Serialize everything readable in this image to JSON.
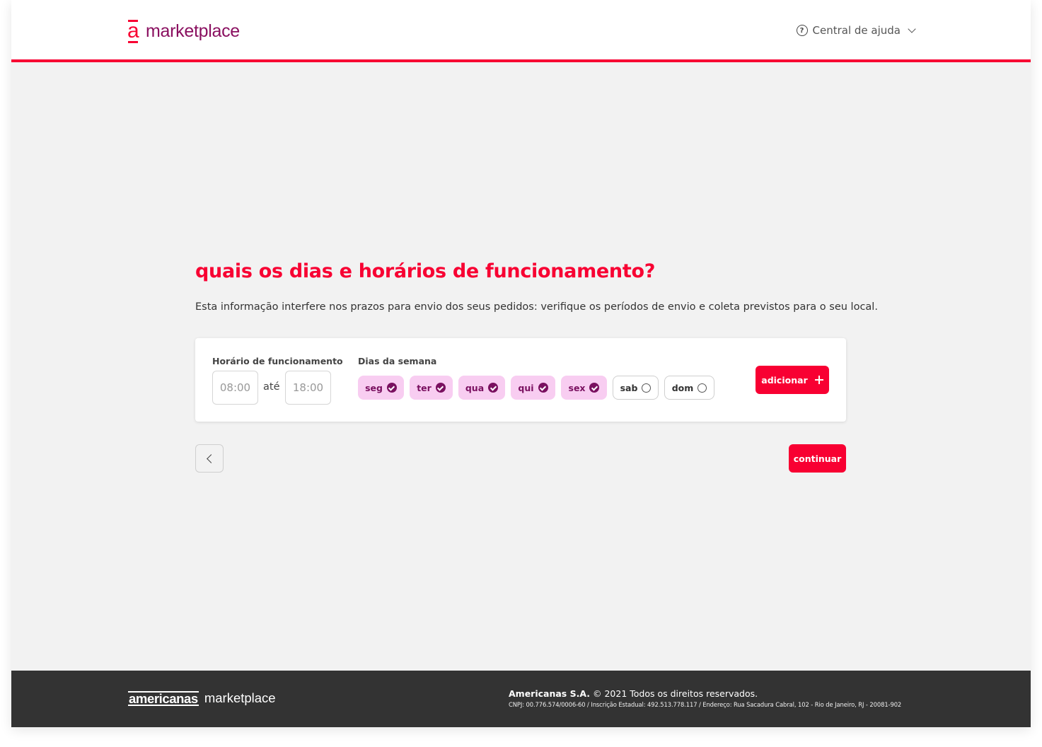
{
  "header": {
    "logo_mark": "a",
    "logo_text": "marketplace",
    "help_label": "Central de ajuda",
    "help_icon": "question-circle-icon",
    "chevron_icon": "chevron-down-icon"
  },
  "main": {
    "title": "quais os dias e horários de funcionamento?",
    "subtitle": "Esta informação interfere nos prazos para envio dos seus pedidos: verifique os períodos de envio e coleta previstos para o seu local.",
    "hours": {
      "label": "Horário de funcionamento",
      "from_placeholder": "08:00",
      "to_placeholder": "18:00",
      "separator": "até"
    },
    "days": {
      "label": "Dias da semana",
      "items": [
        {
          "label": "seg",
          "selected": true
        },
        {
          "label": "ter",
          "selected": true
        },
        {
          "label": "qua",
          "selected": true
        },
        {
          "label": "qui",
          "selected": true
        },
        {
          "label": "sex",
          "selected": true
        },
        {
          "label": "sab",
          "selected": false
        },
        {
          "label": "dom",
          "selected": false
        }
      ]
    },
    "add_label": "adicionar",
    "continue_label": "continuar"
  },
  "footer": {
    "brand": "americanas",
    "brand_suffix": "marketplace",
    "company": "Americanas S.A.",
    "copyright": "© 2021 Todos os direitos reservados.",
    "legal": "CNPJ: 00.776.574/0006-60 / Inscrição Estadual: 492.513.778.117 / Endereço: Rua Sacadura Cabral, 102 - Rio de Janeiro, RJ - 20081-902"
  },
  "colors": {
    "accent": "#f80032",
    "brand_purple": "#8a1060",
    "chip_selected_bg": "#f8cdf1",
    "footer_bg": "#333333",
    "page_bg": "#f2f2f2"
  }
}
